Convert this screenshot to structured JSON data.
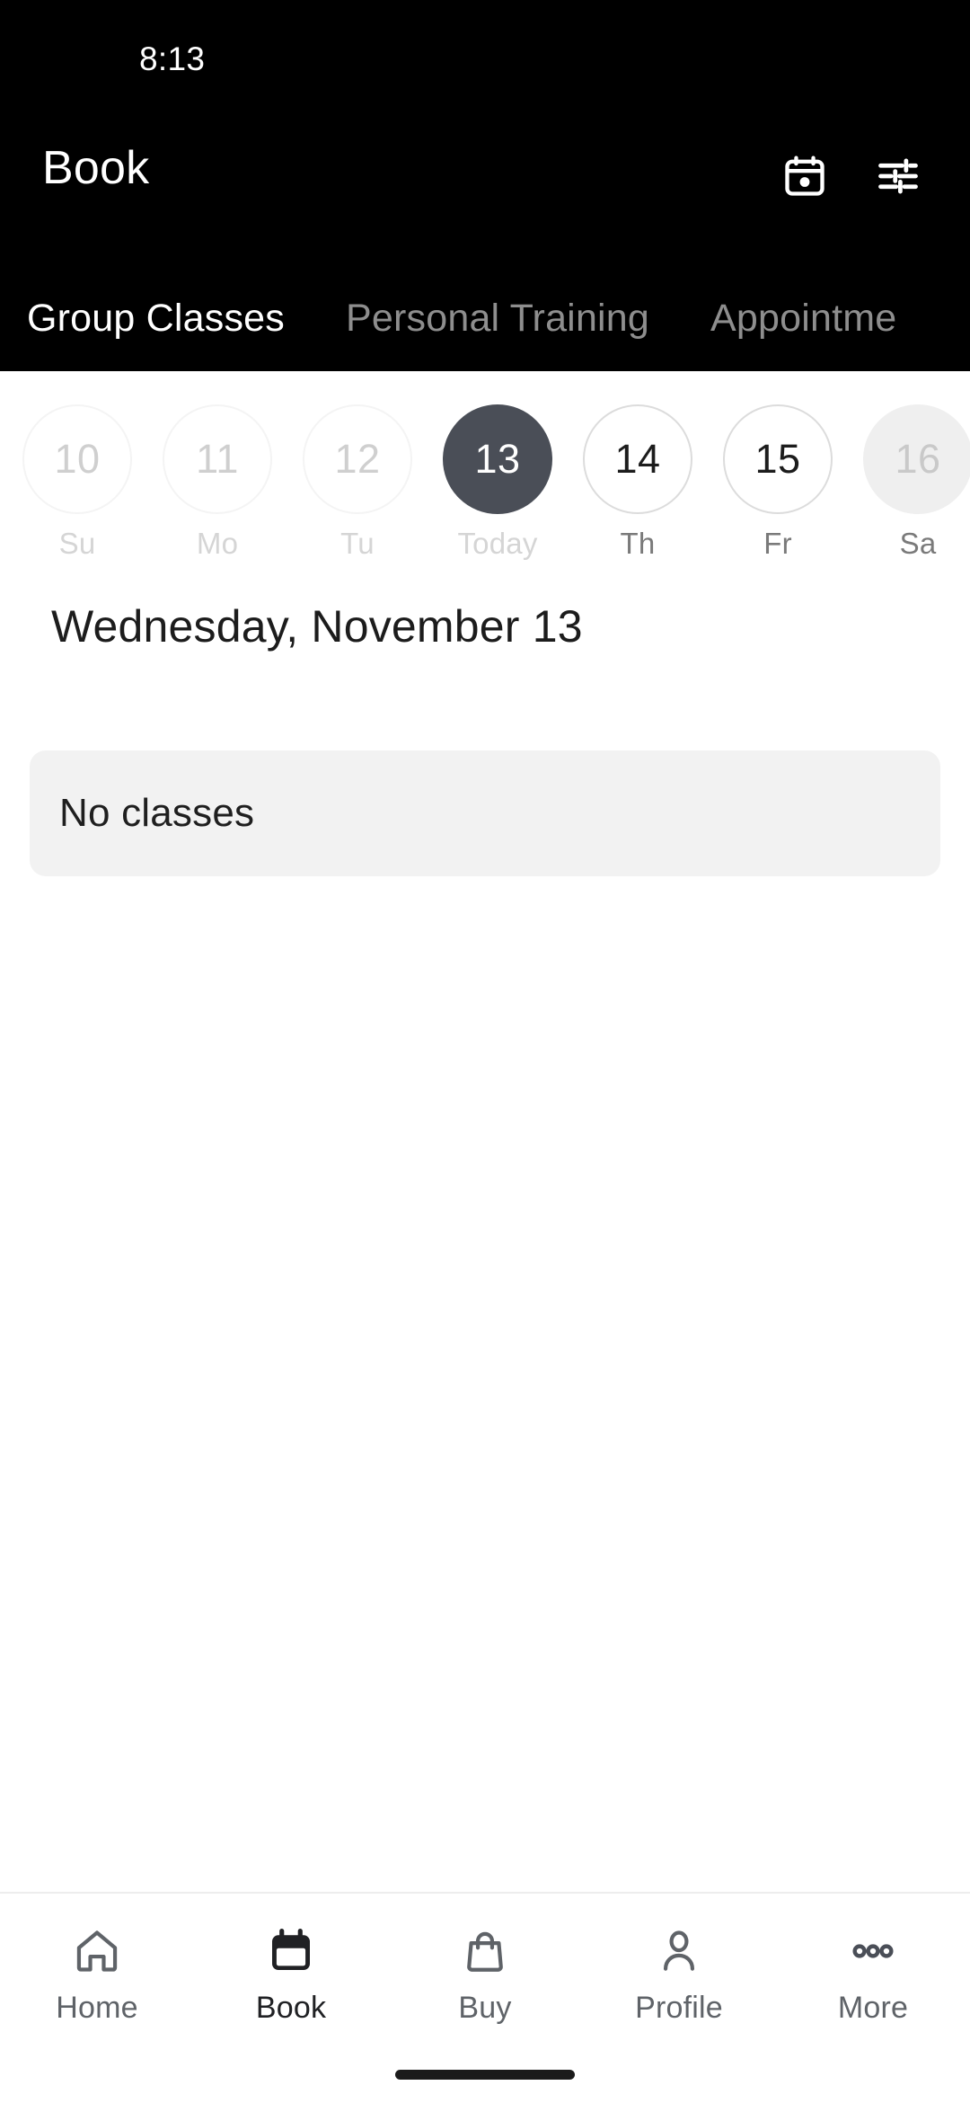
{
  "status_bar": {
    "time": "8:13"
  },
  "header": {
    "title": "Book",
    "actions": [
      {
        "name": "calendar-icon",
        "label": "Calendar"
      },
      {
        "name": "filter-icon",
        "label": "Filters"
      }
    ]
  },
  "tabs": [
    {
      "label": "Group Classes",
      "active": true
    },
    {
      "label": "Personal Training",
      "active": false
    },
    {
      "label": "Appointme",
      "active": false
    }
  ],
  "date_strip": [
    {
      "date": "10",
      "day": "Su",
      "state": "past"
    },
    {
      "date": "11",
      "day": "Mo",
      "state": "past"
    },
    {
      "date": "12",
      "day": "Tu",
      "state": "past"
    },
    {
      "date": "13",
      "day": "Today",
      "state": "selected"
    },
    {
      "date": "14",
      "day": "Th",
      "state": "future"
    },
    {
      "date": "15",
      "day": "Fr",
      "state": "future"
    },
    {
      "date": "16",
      "day": "Sa",
      "state": "muted"
    }
  ],
  "main": {
    "date_heading": "Wednesday, November 13",
    "empty_state": "No classes"
  },
  "bottom_nav": [
    {
      "label": "Home",
      "icon": "home-icon",
      "active": false
    },
    {
      "label": "Book",
      "icon": "calendar-icon",
      "active": true
    },
    {
      "label": "Buy",
      "icon": "bag-icon",
      "active": false
    },
    {
      "label": "Profile",
      "icon": "person-icon",
      "active": false
    },
    {
      "label": "More",
      "icon": "more-icon",
      "active": false
    }
  ],
  "colors": {
    "header_bg": "#000000",
    "selected_day": "#4a4e57",
    "card_bg": "#f2f2f2",
    "nav_active": "#202124",
    "nav_inactive": "#5f6368"
  }
}
